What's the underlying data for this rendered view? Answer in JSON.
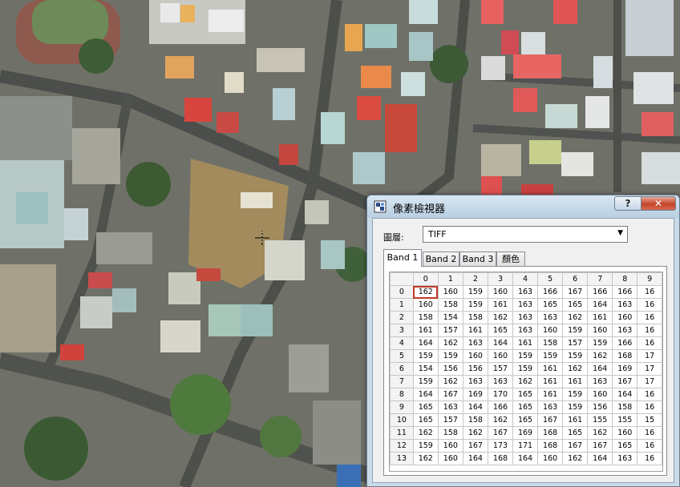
{
  "dialog": {
    "title": "像素檢視器",
    "help_label": "?",
    "close_label": "✕",
    "layer_label": "圖層:",
    "layer_value": "TIFF"
  },
  "tabs": [
    {
      "label": "Band 1",
      "active": true
    },
    {
      "label": "Band 2",
      "active": false
    },
    {
      "label": "Band 3",
      "active": false
    },
    {
      "label": "顏色",
      "active": false
    }
  ],
  "table": {
    "columns": [
      "0",
      "1",
      "2",
      "3",
      "4",
      "5",
      "6",
      "7",
      "8",
      "9"
    ],
    "rows": [
      {
        "label": "0",
        "values": [
          "162",
          "160",
          "159",
          "160",
          "163",
          "166",
          "167",
          "166",
          "166",
          "16"
        ]
      },
      {
        "label": "1",
        "values": [
          "160",
          "158",
          "159",
          "161",
          "163",
          "165",
          "165",
          "164",
          "163",
          "16"
        ]
      },
      {
        "label": "2",
        "values": [
          "158",
          "154",
          "158",
          "162",
          "163",
          "163",
          "162",
          "161",
          "160",
          "16"
        ]
      },
      {
        "label": "3",
        "values": [
          "161",
          "157",
          "161",
          "165",
          "163",
          "160",
          "159",
          "160",
          "163",
          "16"
        ]
      },
      {
        "label": "4",
        "values": [
          "164",
          "162",
          "163",
          "164",
          "161",
          "158",
          "157",
          "159",
          "166",
          "16"
        ]
      },
      {
        "label": "5",
        "values": [
          "159",
          "159",
          "160",
          "160",
          "159",
          "159",
          "159",
          "162",
          "168",
          "17"
        ]
      },
      {
        "label": "6",
        "values": [
          "154",
          "156",
          "156",
          "157",
          "159",
          "161",
          "162",
          "164",
          "169",
          "17"
        ]
      },
      {
        "label": "7",
        "values": [
          "159",
          "162",
          "163",
          "163",
          "162",
          "161",
          "161",
          "163",
          "167",
          "17"
        ]
      },
      {
        "label": "8",
        "values": [
          "164",
          "167",
          "169",
          "170",
          "165",
          "161",
          "159",
          "160",
          "164",
          "16"
        ]
      },
      {
        "label": "9",
        "values": [
          "165",
          "163",
          "164",
          "166",
          "165",
          "163",
          "159",
          "156",
          "158",
          "16"
        ]
      },
      {
        "label": "10",
        "values": [
          "165",
          "157",
          "158",
          "162",
          "165",
          "167",
          "161",
          "155",
          "155",
          "15"
        ]
      },
      {
        "label": "11",
        "values": [
          "162",
          "158",
          "162",
          "167",
          "169",
          "168",
          "165",
          "162",
          "160",
          "16"
        ]
      },
      {
        "label": "12",
        "values": [
          "159",
          "160",
          "167",
          "173",
          "171",
          "168",
          "167",
          "167",
          "165",
          "16"
        ]
      },
      {
        "label": "13",
        "values": [
          "162",
          "160",
          "164",
          "168",
          "164",
          "160",
          "162",
          "164",
          "163",
          "16"
        ]
      }
    ]
  },
  "colors": {
    "selected_cell_outline": "#c0392b",
    "close_button": "#c4442b"
  },
  "icons": {
    "title_icon": "pixel-inspector-icon",
    "cursor": "crosshair-cursor-icon",
    "dropdown": "chevron-down-icon"
  }
}
